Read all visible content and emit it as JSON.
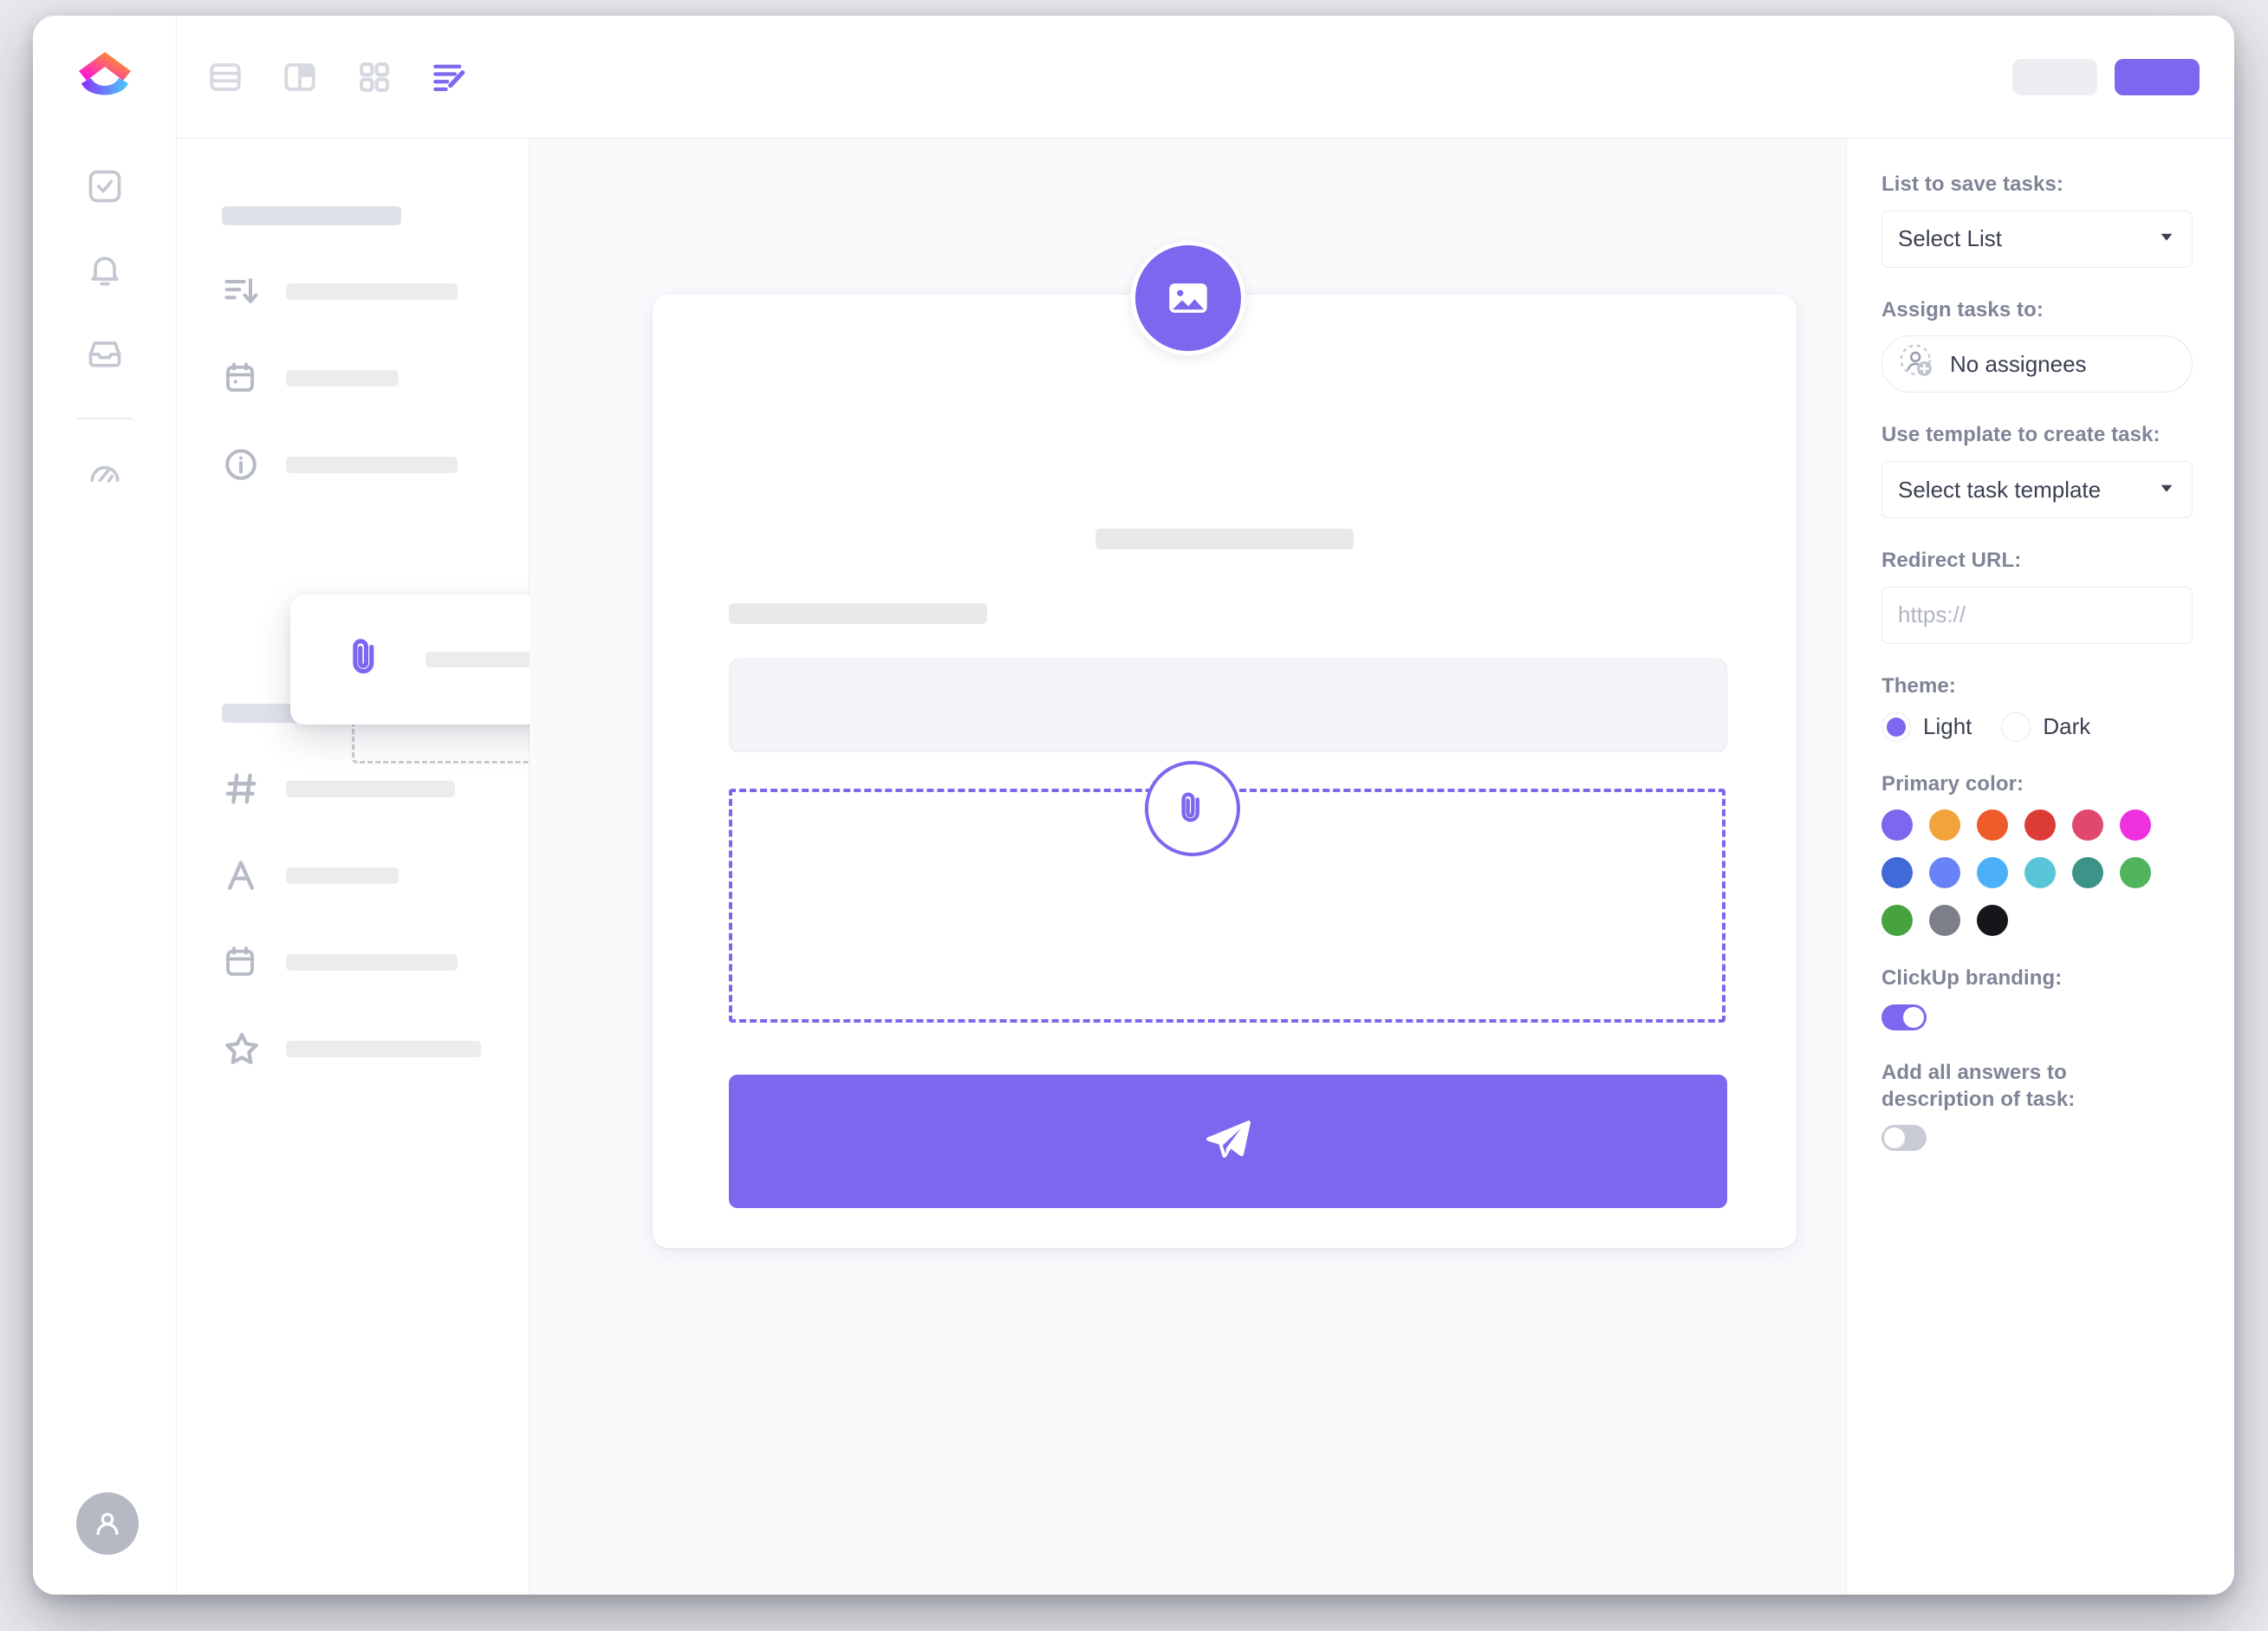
{
  "app": {
    "name": "ClickUp",
    "logo_icon": "clickup-logo"
  },
  "toolbar": {
    "views": [
      {
        "name": "list-view",
        "icon": "list-view-icon",
        "active": false
      },
      {
        "name": "board-view",
        "icon": "board-view-icon",
        "active": false
      },
      {
        "name": "box-view",
        "icon": "grid-view-icon",
        "active": false
      },
      {
        "name": "form-view",
        "icon": "form-view-icon",
        "active": true
      }
    ]
  },
  "rail": {
    "items": [
      {
        "name": "tasks",
        "icon": "checkbox-icon"
      },
      {
        "name": "notifications",
        "icon": "bell-icon"
      },
      {
        "name": "inbox",
        "icon": "inbox-icon"
      },
      {
        "name": "dashboards",
        "icon": "dashboard-icon"
      }
    ],
    "avatar_icon": "user-avatar-icon"
  },
  "sidebar": {
    "groups": [
      {
        "fields": [
          {
            "icon": "sort-descending-icon"
          },
          {
            "icon": "calendar-icon"
          },
          {
            "icon": "info-circle-icon"
          }
        ]
      },
      {
        "fields": [
          {
            "icon": "hash-icon"
          },
          {
            "icon": "text-letter-icon"
          },
          {
            "icon": "calendar-icon"
          },
          {
            "icon": "star-icon"
          }
        ]
      }
    ],
    "drag_card": {
      "icon": "attachment-icon"
    }
  },
  "canvas": {
    "cover_icon": "image-icon",
    "attachment_badge_icon": "attachment-icon",
    "submit_icon": "send-paper-plane-icon"
  },
  "panel": {
    "list_label": "List to save tasks:",
    "list_value": "Select List",
    "assign_label": "Assign tasks to:",
    "assign_value": "No assignees",
    "assign_icon": "add-assignee-icon",
    "template_label": "Use template to create task:",
    "template_value": "Select task template",
    "redirect_label": "Redirect URL:",
    "redirect_placeholder": "https://",
    "redirect_value": "",
    "theme_label": "Theme:",
    "theme_options": [
      {
        "label": "Light",
        "selected": true
      },
      {
        "label": "Dark",
        "selected": false
      }
    ],
    "primary_color_label": "Primary color:",
    "primary_colors": [
      "#7b68ee",
      "#f2a council",
      "#ed5c2a",
      "#dd3c36",
      "#e0486c",
      "#ee30e0",
      "#4169d8",
      "#6883f7",
      "#4cb0f8",
      "#58c6d8",
      "#3c9489",
      "#51b35b",
      "#47a340",
      "#7c7e8a",
      "#16161a"
    ],
    "selected_primary_color": "#7b68ee",
    "branding_label": "ClickUp branding:",
    "branding_on": true,
    "answers_label": "Add all answers to description of task:",
    "answers_on": false,
    "caret_icon": "chevron-down-icon"
  }
}
